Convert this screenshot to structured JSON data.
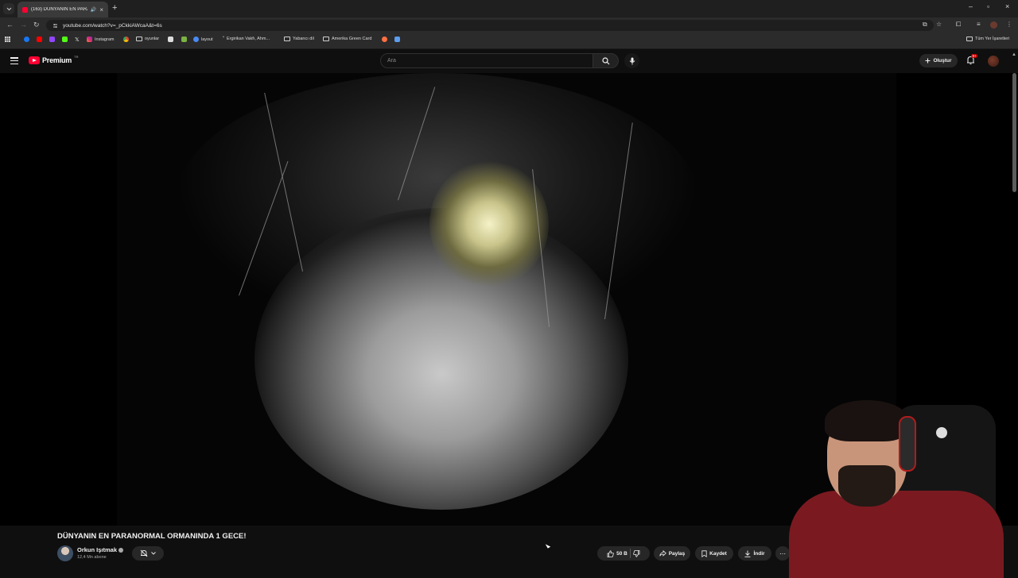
{
  "browser": {
    "tab_title": "(163) DÜNYANIN EN PARA...",
    "url": "youtube.com/watch?v=_pCkkiAWcaA&t=6s"
  },
  "bookmarks": [
    {
      "label": "Instagram"
    },
    {
      "label": "oyunlar"
    },
    {
      "label": "layout"
    },
    {
      "label": "Ergirikan Vakfı, Ahm..."
    },
    {
      "label": "Yabancı dil"
    },
    {
      "label": "Amerika Green Card"
    },
    {
      "label": "Tüm Yer İşaretleri"
    }
  ],
  "masthead": {
    "logo_text": "Premium",
    "logo_country": "TR",
    "search_placeholder": "Ara",
    "create_label": "Oluştur",
    "notification_badge": "9+"
  },
  "video": {
    "title": "DÜNYANIN EN PARANORMAL ORMANINDA 1 GECE!",
    "channel_name": "Orkun Işıtmak",
    "subscribers": "12,4 Mn abone"
  },
  "actions": {
    "like_count": "50 B",
    "share_label": "Paylaş",
    "save_label": "Kaydet",
    "download_label": "İndir"
  },
  "colors": {
    "background": "#0f0f0f",
    "brand_red": "#ff0033",
    "pill_bg": "#272727"
  },
  "icons": [
    "menu-icon",
    "youtube-logo-icon",
    "search-icon",
    "mic-icon",
    "plus-icon",
    "bell-icon",
    "like-icon",
    "dislike-icon",
    "share-icon",
    "save-icon",
    "download-icon",
    "more-icon",
    "bell-off-icon",
    "chevron-down-icon"
  ]
}
